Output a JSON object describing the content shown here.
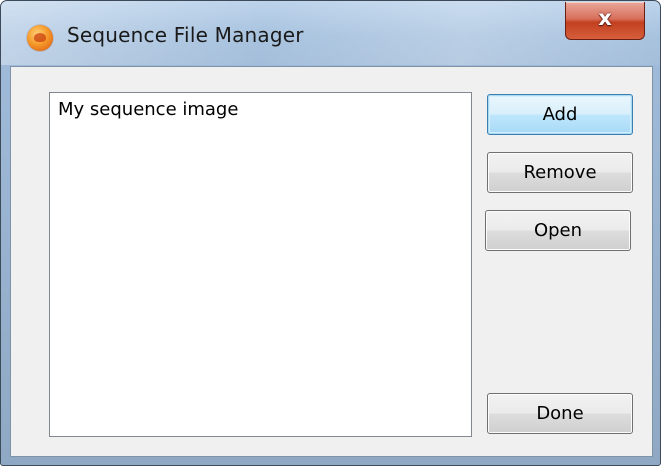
{
  "window": {
    "title": "Sequence File Manager",
    "close_glyph": "x"
  },
  "listbox": {
    "items": [
      "My sequence image"
    ]
  },
  "buttons": {
    "add": "Add",
    "remove": "Remove",
    "open": "Open",
    "done": "Done"
  },
  "colors": {
    "titlebar": "#a3bfdd",
    "close_button": "#c2401f",
    "client_background": "#f0f0f0",
    "default_button_border": "#3c7fb1"
  },
  "icons": {
    "app": "app-icon",
    "close": "close-icon"
  }
}
